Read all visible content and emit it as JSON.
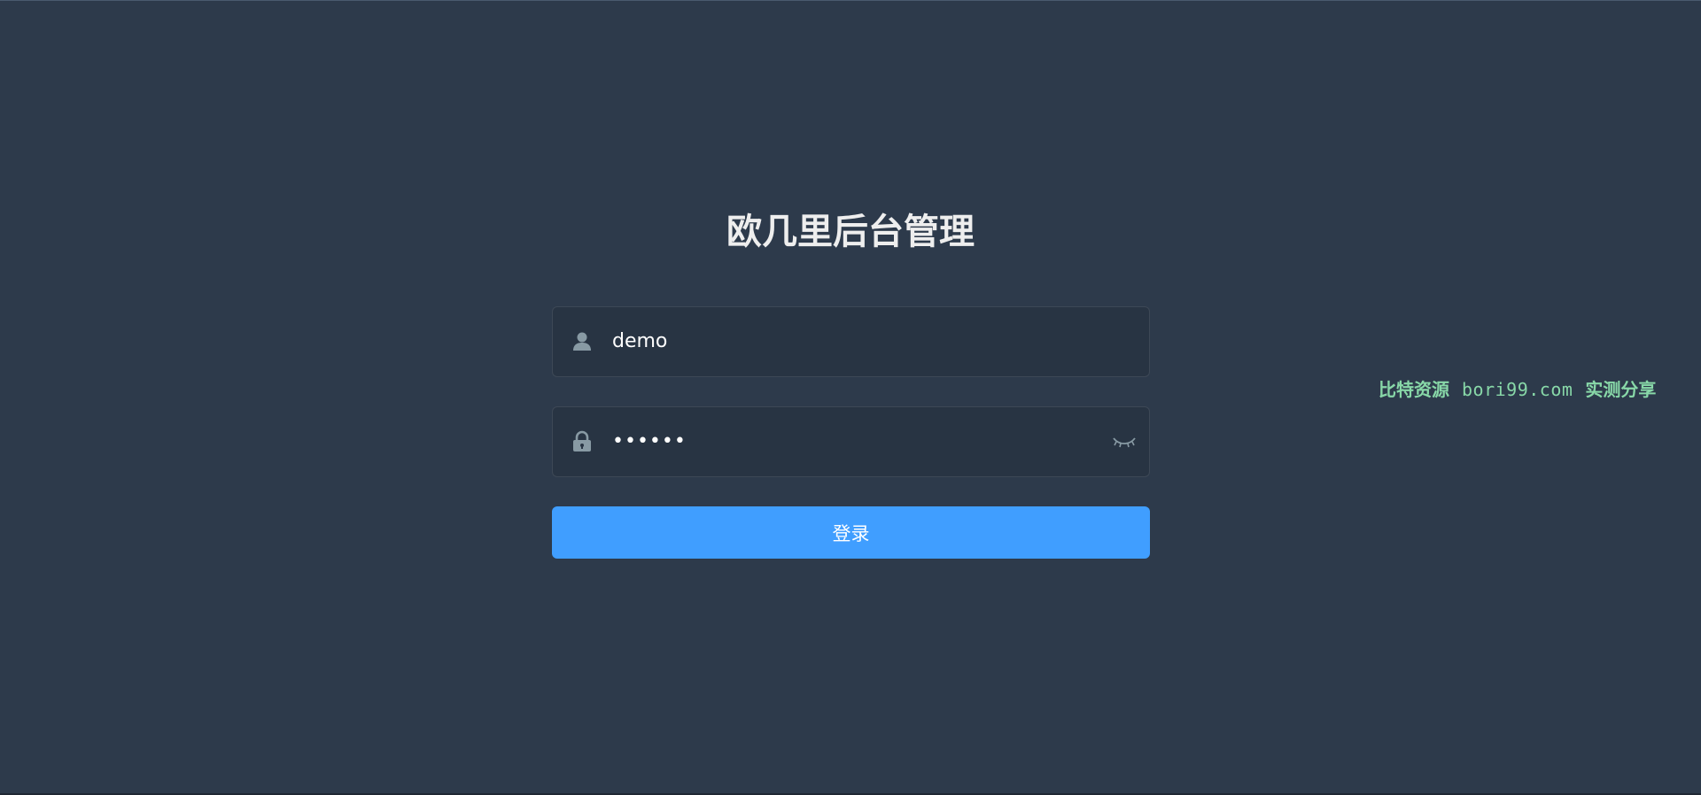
{
  "login": {
    "title": "欧几里后台管理",
    "username": {
      "value": "demo",
      "icon": "user-icon"
    },
    "password": {
      "value": "••••••",
      "icon": "lock-icon",
      "toggle_icon": "eye-closed-icon"
    },
    "submit_label": "登录"
  },
  "watermark": {
    "left": "比特资源",
    "url": "bori99.com",
    "right": "实测分享"
  },
  "colors": {
    "background": "#2d3a4b",
    "input_background": "#283443",
    "button": "#409eff",
    "watermark": "#88d8a8"
  }
}
